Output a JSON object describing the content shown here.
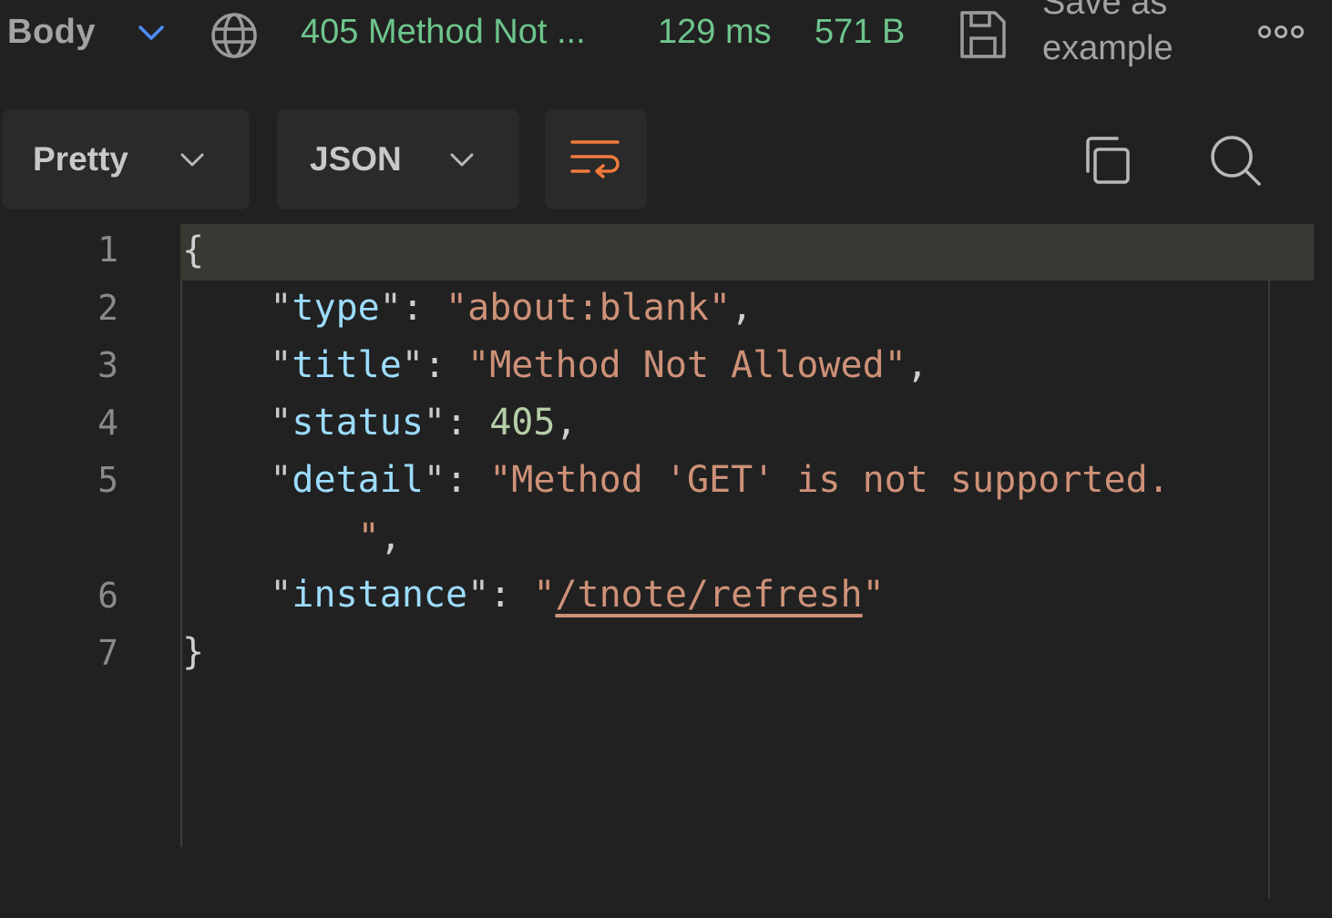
{
  "topbar": {
    "body_label": "Body",
    "status": "405 Method Not ...",
    "time": "129 ms",
    "size": "571 B",
    "save_label": "Save as example",
    "status_color": "#6ec58c"
  },
  "toolbar": {
    "format": "Pretty",
    "language": "JSON"
  },
  "editor": {
    "line_numbers": [
      "1",
      "2",
      "3",
      "4",
      "5",
      "6",
      "7"
    ],
    "open_brace": "{",
    "close_brace": "}",
    "fields": {
      "type_key": "type",
      "type_value": "about:blank",
      "title_key": "title",
      "title_value": "Method Not Allowed",
      "status_key": "status",
      "status_value": "405",
      "detail_key": "detail",
      "detail_value_part1": "Method 'GET' is not supported.",
      "instance_key": "instance",
      "instance_value": "/tnote/refresh"
    },
    "colors": {
      "key": "#9cdcfe",
      "string": "#ce9178",
      "number": "#b5cea8"
    }
  }
}
